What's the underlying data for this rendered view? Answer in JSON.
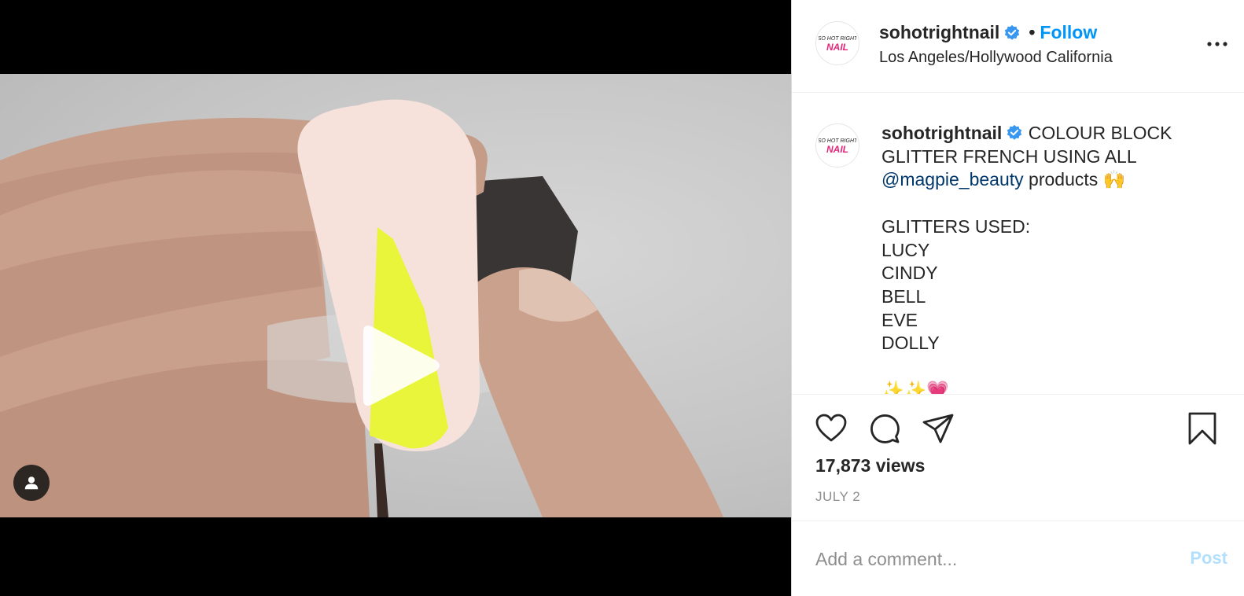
{
  "post": {
    "username": "sohotrightnail",
    "verified": true,
    "separator": "•",
    "follow_label": "Follow",
    "location": "Los Angeles/Hollywood California",
    "avatar_text": "SO HOT RIGHT NAIL",
    "caption": {
      "line1": "COLOUR BLOCK",
      "line2": "GLITTER FRENCH USING ALL",
      "mention": "@magpie_beauty",
      "line3_rest": " products 🙌",
      "glitters_heading": "GLITTERS USED:",
      "glitters": [
        "LUCY",
        "CINDY",
        "BELL",
        "EVE",
        "DOLLY"
      ],
      "trailing_emoji": "✨✨💗"
    },
    "views": "17,873 views",
    "date": "JULY 2"
  },
  "comment": {
    "placeholder": "Add a comment...",
    "post_label": "Post"
  },
  "colors": {
    "accent": "#0095f6",
    "verified": "#3897f0",
    "post_disabled": "#b2dffc",
    "mention": "#00376b",
    "neon_polish": "#e8f53a"
  },
  "icons": [
    "play-icon",
    "user-tag-icon",
    "verified-badge-icon",
    "more-options-icon",
    "heart-icon",
    "comment-icon",
    "share-icon",
    "bookmark-icon"
  ]
}
